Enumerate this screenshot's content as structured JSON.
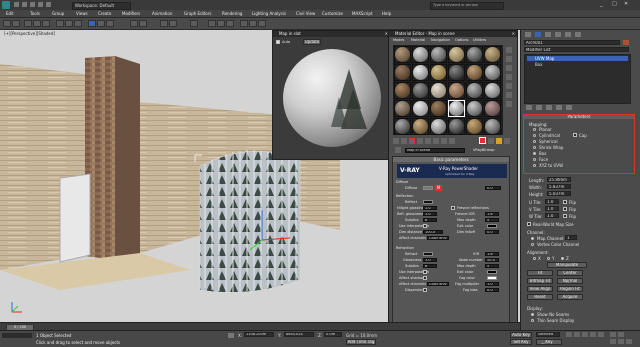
{
  "window": {
    "title": "Workspace: Default",
    "search_placeholder": "Type a keyword or phrase"
  },
  "menu": [
    "Edit",
    "Tools",
    "Group",
    "Views",
    "Create",
    "Modifiers",
    "Animation",
    "Graph Editors",
    "Rendering",
    "Lighting Analysis",
    "Civil View",
    "Customize",
    "MAXScript",
    "Help"
  ],
  "viewport": {
    "label": "[+][Perspective][Shaded]"
  },
  "preview_window": {
    "title": "Map in slot",
    "auto_label": "Auto",
    "update_label": "Update"
  },
  "material_editor": {
    "title": "Material Editor - Map in scene",
    "menu": [
      "Modes",
      "Material",
      "Navigation",
      "Options",
      "Utilities"
    ],
    "map_name_field": "Map in scene",
    "map_type": "VRayBitmap",
    "basic_rollout": "Basic parameters",
    "vray_brand": "V-RAY",
    "vray_title": "V-Ray PowerShader",
    "vray_subtitle": "optimized for V-Ray",
    "diffuse": {
      "section": "Diffuse",
      "diffuse_label": "Diffuse",
      "map_badge": "M",
      "roughness_label": "Roughness",
      "roughness_value": "0.0"
    },
    "reflection": {
      "section": "Reflection",
      "reflect": "Reflect",
      "hglossiness": "Hilight glossiness",
      "hglossiness_value": "1.0",
      "rglossiness": "Refl. glossiness",
      "rglossiness_value": "1.0",
      "subdivs": "Subdivs",
      "subdivs_value": "8",
      "use_interp": "Use interpolation",
      "dim_distance": "Dim distance",
      "dim_distance_value": "100.0",
      "affect_channels": "Affect channels",
      "affect_channels_value": "Color only",
      "fresnel": "Fresnel reflections",
      "fresnel_ior": "Fresnel IOR",
      "fresnel_ior_value": "1.6",
      "max_depth": "Max depth",
      "max_depth_value": "5",
      "exit_color": "Exit color",
      "dim_falloff": "Dim falloff",
      "dim_falloff_value": "0.0"
    },
    "refraction": {
      "section": "Refraction",
      "refract": "Refract",
      "glossiness": "Glossiness",
      "glossiness_value": "1.0",
      "subdivs": "Subdivs",
      "subdivs_value": "8",
      "use_interp": "Use interpolation",
      "affect_shadows": "Affect shadows",
      "affect_channels": "Affect channels",
      "affect_channels_value": "Color only",
      "dispersion": "Dispersion",
      "ior": "IOR",
      "ior_value": "1.6",
      "abbe": "Abbe number",
      "abbe_value": "50.0",
      "max_depth": "Max depth",
      "max_depth_value": "5",
      "exit_color": "Exit color",
      "fog_color": "Fog color",
      "fog_multiplier": "Fog multiplier",
      "fog_multiplier_value": "1.0",
      "fog_bias": "Fog bias",
      "fog_bias_value": "0.0"
    }
  },
  "command_panel": {
    "object_name": "Arch001",
    "modifier_list": "Modifier List",
    "stack": [
      "UVW Map",
      "Box"
    ],
    "parameters_rollout": "Parameters",
    "mapping_label": "Mapping:",
    "mapping_options": [
      "Planar",
      "Cylindrical",
      "Spherical",
      "Shrink Wrap",
      "Box",
      "Face",
      "XYZ to UVW"
    ],
    "cap_label": "Cap",
    "length_label": "Length:",
    "length_value": "25.866m",
    "width_label": "Width:",
    "width_value": "5.837m",
    "height_label": "Height:",
    "height_value": "5.037m",
    "utile_label": "U Tile:",
    "utile_value": "1.0",
    "vtile_label": "V Tile:",
    "vtile_value": "1.0",
    "wtile_label": "W Tile:",
    "wtile_value": "1.0",
    "flip_label": "Flip",
    "realworld": "Real-World Map Size",
    "channel_label": "Channel:",
    "map_channel": "Map Channel:",
    "map_channel_value": "1",
    "vertex_color": "Vertex Color Channel",
    "alignment_label": "Alignment:",
    "align_axes": [
      "X",
      "Y",
      "Z"
    ],
    "manipulate": "Manipulate",
    "buttons": [
      "Fit",
      "Center",
      "Bitmap Fit",
      "Normal Align",
      "View Align",
      "Region Fit",
      "Reset",
      "Acquire"
    ],
    "display_label": "Display:",
    "show_no_seams": "Show No Seams",
    "thin_seam": "Thin Seam Display"
  },
  "timeline": {
    "frame": "0 / 100"
  },
  "status": {
    "selected": "1 Object Selected",
    "prompt": "Click and drag to select and move objects",
    "x_label": "X:",
    "x_value": "1108.200m",
    "y_label": "Y:",
    "y_value": "8644.024",
    "z_label": "Z:",
    "z_value": "0.0m",
    "grid": "Grid = 10.0mm",
    "add_time_tag": "Add Time Tag",
    "auto_key": "Auto Key",
    "selected_dd": "Selected",
    "set_key": "Set Key",
    "key_filters": "Key Filters..."
  },
  "colors": {
    "highlight": "#e03030",
    "selection_blue": "#3a62b5",
    "viewport_bg": "#d4d4d4"
  }
}
